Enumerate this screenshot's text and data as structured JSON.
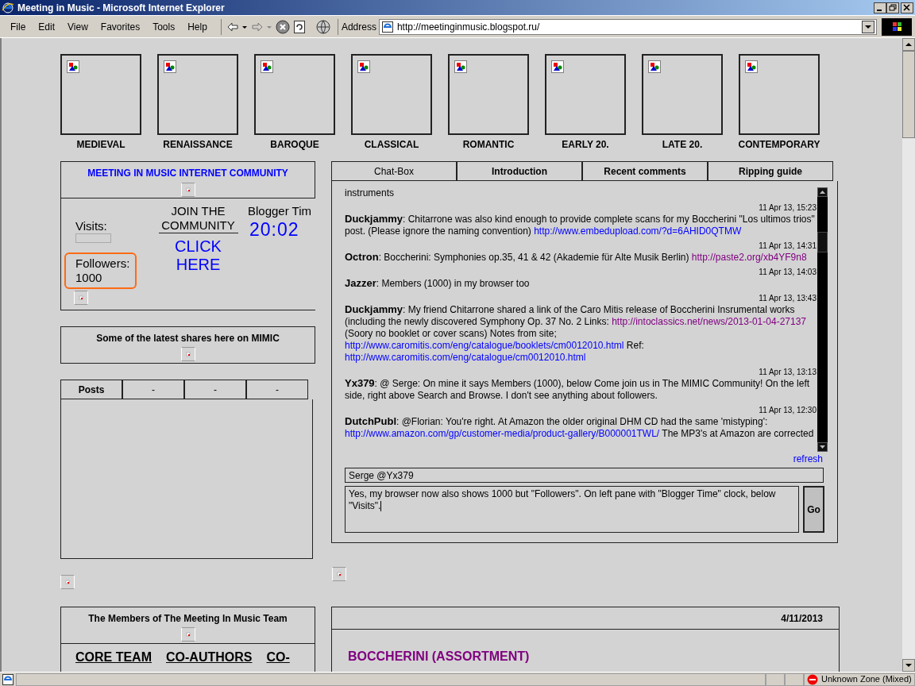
{
  "window": {
    "title": "Meeting in Music - Microsoft Internet Explorer"
  },
  "menu": [
    "File",
    "Edit",
    "View",
    "Favorites",
    "Tools",
    "Help"
  ],
  "address": {
    "label": "Address",
    "value": "http://meetinginmusic.blogspot.ru/"
  },
  "genres": [
    "MEDIEVAL",
    "RENAISSANCE",
    "BAROQUE",
    "CLASSICAL",
    "ROMANTIC",
    "EARLY 20.",
    "LATE 20.",
    "CONTEMPORARY"
  ],
  "community": {
    "title": "MEETING IN MUSIC INTERNET COMMUNITY",
    "visits_label": "Visits:",
    "followers_label": "Followers:",
    "followers": "1000",
    "highlighted": true,
    "join": "JOIN THE COMMUNITY",
    "click": "CLICK HERE",
    "clock_label": "Blogger Tim",
    "clock": "20:02"
  },
  "shares": {
    "title": "Some of the latest shares here on MIMIC"
  },
  "posts_tabs": [
    "Posts",
    "-",
    "-",
    "-"
  ],
  "chat_tabs": [
    {
      "label": "Chat-Box",
      "selected": true
    },
    {
      "label": "Introduction",
      "selected": false
    },
    {
      "label": "Recent comments",
      "selected": false
    },
    {
      "label": "Ripping guide",
      "selected": false
    }
  ],
  "chat": {
    "messages": [
      {
        "segments": [
          {
            "kind": "text",
            "text": "instruments"
          }
        ]
      },
      {
        "time": "11 Apr 13, 15:23",
        "author": "Duckjammy",
        "segments": [
          {
            "kind": "text",
            "text": ": Chitarrone was also kind enough to provide complete scans for my Boccherini \"Los ultimos trios\" post. (Please ignore the naming convention) "
          },
          {
            "kind": "link",
            "text": "http://www.embedupload.com/?d=6AHID0QTMW",
            "visited": false
          }
        ]
      },
      {
        "time": "11 Apr 13, 14:31",
        "author": "Octron",
        "segments": [
          {
            "kind": "text",
            "text": ": Boccherini: Symphonies op.35, 41 & 42 (Akademie für Alte Musik Berlin) "
          },
          {
            "kind": "link",
            "text": "http://paste2.org/xb4YF9n8",
            "visited": true
          }
        ]
      },
      {
        "time": "11 Apr 13, 14:03",
        "author": "Jazzer",
        "segments": [
          {
            "kind": "text",
            "text": ": Members (1000) in my browser too"
          }
        ]
      },
      {
        "time": "11 Apr 13, 13:43",
        "author": "Duckjammy",
        "segments": [
          {
            "kind": "text",
            "text": ": My friend Chitarrone shared a link of the Caro Mitis release of Boccherini Insrumental works (including the newly discovered Symphony Op. 37 No. 2 Links: "
          },
          {
            "kind": "link",
            "text": "http://intoclassics.net/news/2013-01-04-27137",
            "visited": true
          },
          {
            "kind": "text",
            "text": " (Soory no booklet or cover scans) Notes from site; "
          },
          {
            "kind": "link",
            "text": "http://www.caromitis.com/eng/catalogue/booklets/cm0012010.html",
            "visited": false
          },
          {
            "kind": "text",
            "text": " Ref: "
          },
          {
            "kind": "link",
            "text": "http://www.caromitis.com/eng/catalogue/cm0012010.html",
            "visited": false
          }
        ]
      },
      {
        "time": "11 Apr 13, 13:13",
        "author": "Yx379",
        "segments": [
          {
            "kind": "text",
            "text": ": @ Serge: On mine it says Members (1000), below Come join us in The MIMIC Community! On the left side, right above Search and Browse. I don't see anything about followers."
          }
        ]
      },
      {
        "time": "11 Apr 13, 12:30",
        "author": "DutchPubl",
        "segments": [
          {
            "kind": "text",
            "text": ": @Florian: You're right. At Amazon the older original DHM CD had the same 'mistyping': "
          },
          {
            "kind": "link",
            "text": "http://www.amazon.com/gp/customer-media/product-gallery/B000001TWL/",
            "visited": false
          },
          {
            "kind": "text",
            "text": " The MP3's at Amazon are corrected"
          }
        ]
      }
    ],
    "refresh": "refresh",
    "name_value": "Serge @Yx379",
    "message_value": "Yes, my browser now also shows 1000 but \"Followers\". On left pane with \"Blogger Time\" clock, below \"Visits\".",
    "send": "Go"
  },
  "members": {
    "title": "The Members of The Meeting In Music Team",
    "links": [
      "CORE TEAM",
      "CO-AUTHORS",
      "CO-"
    ]
  },
  "post": {
    "date": "4/11/2013",
    "title": "BOCCHERINI (ASSORTMENT)"
  },
  "status_bar": {
    "zone": "Unknown Zone (Mixed)"
  }
}
